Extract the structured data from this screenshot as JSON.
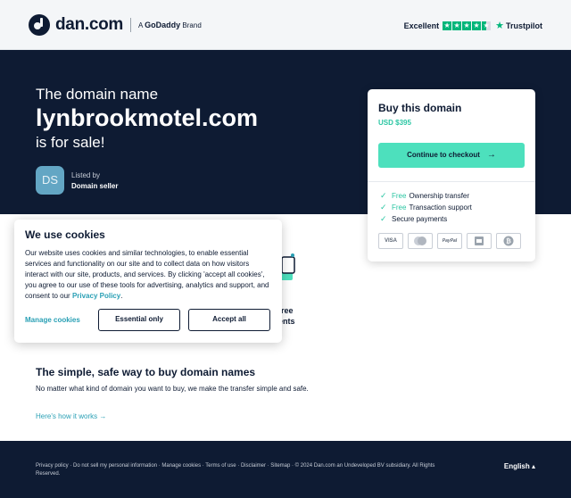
{
  "header": {
    "logo_text": "dan.com",
    "brand_prefix": "A",
    "brand_name": "GoDaddy",
    "brand_suffix": "Brand",
    "trust_label": "Excellent",
    "trust_brand": "Trustpilot",
    "trust_rating_stars": 4.5,
    "trust_color": "#00b67a"
  },
  "hero": {
    "pre_text": "The domain name",
    "domain": "lynbrookmotel.com",
    "post_text": "is for sale!",
    "seller_initials": "DS",
    "seller_label": "Listed by",
    "seller_value": "Domain seller"
  },
  "buy": {
    "title": "Buy this domain",
    "price": "USD $395",
    "checkout_label": "Continue to checkout",
    "features": [
      {
        "highlight": "Free",
        "text": "Ownership transfer"
      },
      {
        "highlight": "Free",
        "text": "Transaction support"
      },
      {
        "highlight": "",
        "text": "Secure payments"
      }
    ],
    "payments": [
      "VISA",
      "mastercard",
      "PayPal",
      "bank",
      "bitcoin"
    ],
    "accent": "#4de0bd"
  },
  "background_feature": {
    "line1": "free",
    "line2": "ents"
  },
  "cookie": {
    "title": "We use cookies",
    "body": "Our website uses cookies and similar technologies, to enable essential services and functionality on our site and to collect data on how visitors interact with our site, products, and services. By clicking 'accept all cookies', you agree to our use of these tools for advertising, analytics and support, and consent to our",
    "policy_link": "Privacy Policy",
    "manage_label": "Manage cookies",
    "essential_label": "Essential only",
    "accept_label": "Accept all"
  },
  "safe": {
    "title": "The simple, safe way to buy domain names",
    "body": "No matter what kind of domain you want to buy, we make the transfer simple and safe.",
    "link": "Here's how it works"
  },
  "footer": {
    "links": "Privacy policy · Do not sell my personal information · Manage cookies · Terms of use · Disclaimer · Sitemap · © 2024 Dan.com an Undeveloped BV subsidiary. All Rights Reserved.",
    "language": "English"
  }
}
